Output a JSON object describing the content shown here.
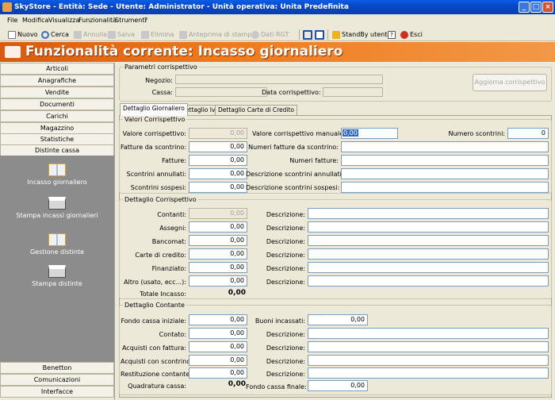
{
  "window": {
    "title": "SkyStore - Entità: Sede - Utente: Administrator - Unità operativa: Unita Predefinita"
  },
  "menu": [
    "File",
    "Modifica",
    "Visualizza",
    "Funzionalità",
    "Strumenti",
    "?"
  ],
  "toolbar": {
    "nuovo": "Nuovo",
    "cerca": "Cerca",
    "annulla": "Annulla",
    "salva": "Salva",
    "elimina": "Elimina",
    "anteprima": "Anteprima di stampa",
    "dati_rgt": "Dati RGT",
    "standby": "StandBy utente",
    "help": "?",
    "esci": "Esci"
  },
  "banner": {
    "title": "Funzionalità corrente:  Incasso giornaliero"
  },
  "sidebar": {
    "top": [
      "Articoli",
      "Anagrafiche",
      "Vendite",
      "Documenti",
      "Carichi",
      "Magazzino",
      "Statistiche",
      "Distinte cassa"
    ],
    "panel": [
      "Incasso giornaliero",
      "Stampa incassi giornalieri",
      "Gestione distinte",
      "Stampa distinte"
    ],
    "bottom": [
      "Benetton",
      "Comunicazioni",
      "Interfacce"
    ]
  },
  "params": {
    "legend": "Parametri corrispettivo",
    "negozio": "Negozio:",
    "cassa": "Cassa:",
    "data": "Data corrispettivo:",
    "aggiorna": "Aggiorna corrispettivo"
  },
  "tabs": [
    "Dettaglio Giornaliero",
    "Dettaglio Iva",
    "Dettaglio Carte di Credito"
  ],
  "valori": {
    "legend": "Valori Corrispettivo",
    "left": [
      {
        "label": "Valore corrispettivo:",
        "value": "0,00"
      },
      {
        "label": "Fatture da scontrino:",
        "value": "0,00"
      },
      {
        "label": "Fatture:",
        "value": "0,00"
      },
      {
        "label": "Scontrini annullati:",
        "value": "0,00"
      },
      {
        "label": "Scontrini sospesi:",
        "value": "0,00"
      }
    ],
    "manuale_label": "Valore corrispettivo manuale:",
    "manuale_value": "0,00",
    "numero_label": "Numero scontrini:",
    "numero_value": "0",
    "right": [
      "Numeri fatture da scontrino:",
      "Numeri fatture:",
      "Descrizione scontrini annullati:",
      "Descrizione scontrini sospesi:"
    ]
  },
  "dett_corr": {
    "legend": "Dettaglio Corrispettivo",
    "rows": [
      {
        "label": "Contanti:",
        "value": "0,00"
      },
      {
        "label": "Assegni:",
        "value": "0,00"
      },
      {
        "label": "Bancomat:",
        "value": "0,00"
      },
      {
        "label": "Carte di credito:",
        "value": "0,00"
      },
      {
        "label": "Finanziato:",
        "value": "0,00"
      },
      {
        "label": "Altro (usato, ecc...):",
        "value": "0,00"
      }
    ],
    "desc": "Descrizione:",
    "totale_label": "Totale Incasso:",
    "totale_value": "0,00"
  },
  "dett_cont": {
    "legend": "Dettaglio Contante",
    "rows": [
      {
        "label": "Fondo cassa iniziale:",
        "value": "0,00"
      },
      {
        "label": "Contato:",
        "value": "0,00"
      },
      {
        "label": "Acquisti con fattura:",
        "value": "0,00"
      },
      {
        "label": "Acquisti con scontrino:",
        "value": "0,00"
      },
      {
        "label": "Restituzione contante:",
        "value": "0,00"
      }
    ],
    "buoni_label": "Buoni incassati:",
    "buoni_value": "0,00",
    "desc": "Descrizione:",
    "quadratura_label": "Quadratura cassa:",
    "quadratura_value": "0,00",
    "fondo_finale_label": "Fondo cassa finale:",
    "fondo_finale_value": "0,00"
  }
}
